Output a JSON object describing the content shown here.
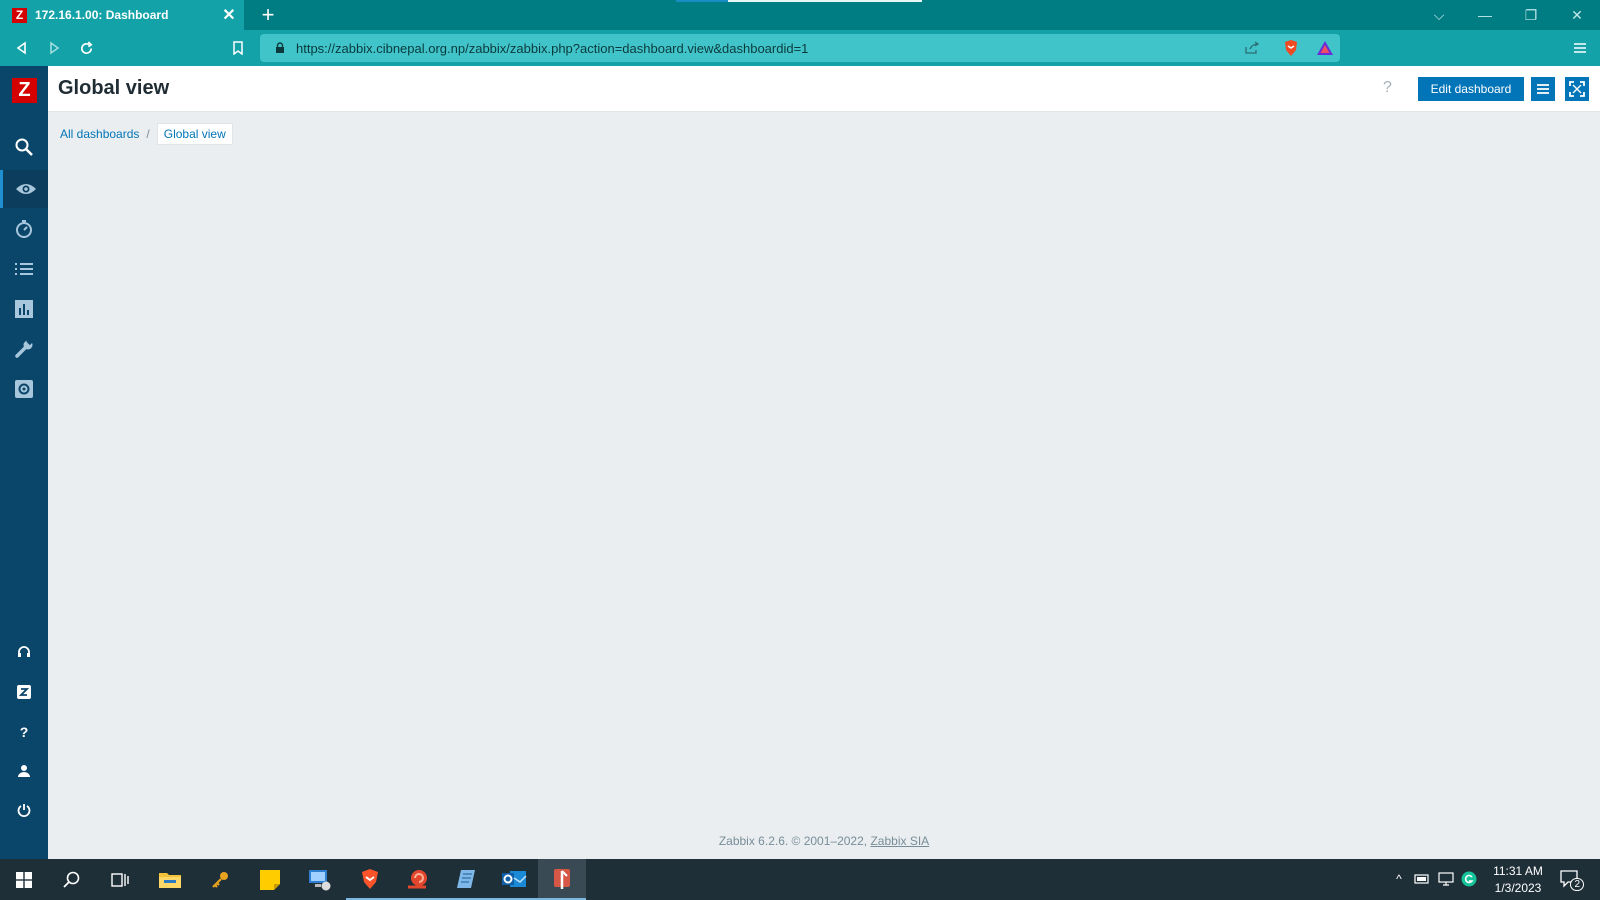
{
  "browser": {
    "tab_title": "172.16.1.00: Dashboard",
    "tab_favicon": "Z",
    "new_tab_label": "+",
    "url_host": "https://zabbix.cibnepal.org.np",
    "url_path": "/zabbix/zabbix.php?action=dashboard.view&dashboardid=1"
  },
  "sidebar": {
    "logo": "Z",
    "items": [
      "search-icon",
      "monitoring-eye-icon",
      "services-icon",
      "inventory-list-icon",
      "reports-chart-icon",
      "data-collection-wrench-icon",
      "administration-gear-icon"
    ],
    "bottom_items": [
      "support-icon",
      "integrations-icon",
      "help-icon",
      "user-settings-icon",
      "sign-out-icon"
    ]
  },
  "header": {
    "title": "Global view",
    "help": "?",
    "edit_label": "Edit dashboard"
  },
  "breadcrumb": {
    "parent": "All dashboards",
    "separator": "/",
    "current": "Global view"
  },
  "footer": {
    "text": "Zabbix 6.2.6. © 2001–2022,",
    "link": "Zabbix SIA"
  },
  "taskbar": {
    "time": "11:31 AM",
    "date": "1/3/2023",
    "notification_count": "2"
  }
}
